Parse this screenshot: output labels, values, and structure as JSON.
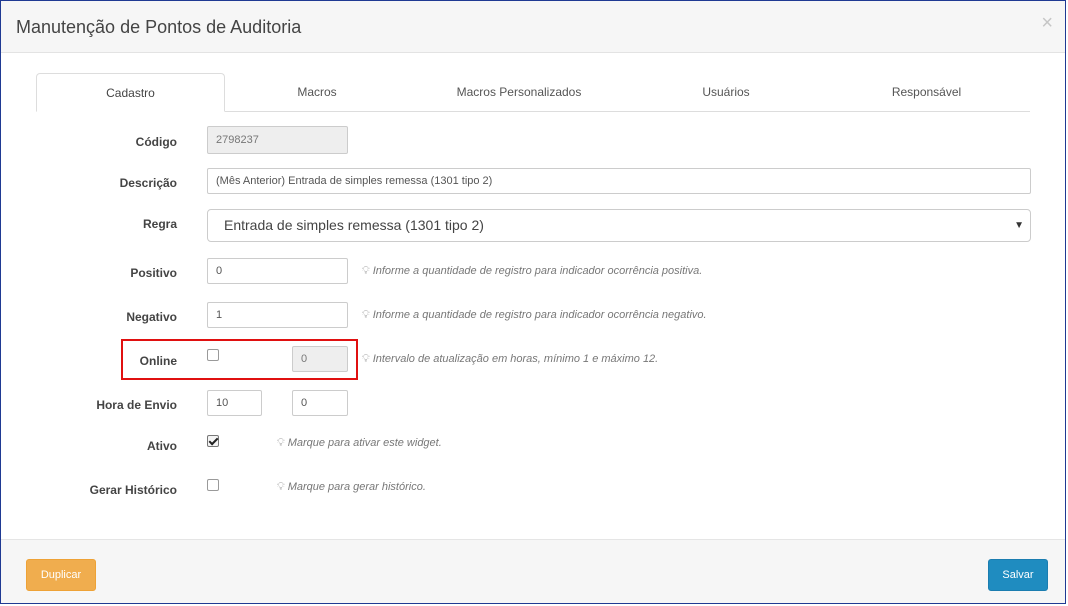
{
  "window": {
    "title": "Manutenção de Pontos de Auditoria",
    "close_symbol": "×"
  },
  "tabs": [
    {
      "label": "Cadastro",
      "active": true
    },
    {
      "label": "Macros",
      "active": false
    },
    {
      "label": "Macros Personalizados",
      "active": false
    },
    {
      "label": "Usuários",
      "active": false
    },
    {
      "label": "Responsável",
      "active": false
    }
  ],
  "form": {
    "codigo": {
      "label": "Código",
      "value": "2798237"
    },
    "descricao": {
      "label": "Descrição",
      "value": "(Mês Anterior) Entrada de simples remessa (1301 tipo 2)"
    },
    "regra": {
      "label": "Regra",
      "selected": "Entrada de simples remessa (1301 tipo 2)"
    },
    "positivo": {
      "label": "Positivo",
      "value": "0",
      "hint": "Informe a quantidade de registro para indicador ocorrência positiva."
    },
    "negativo": {
      "label": "Negativo",
      "value": "1",
      "hint": "Informe a quantidade de registro para indicador ocorrência negativo."
    },
    "online": {
      "label": "Online",
      "checked": false,
      "value": "0",
      "hint": "Intervalo de atualização em horas, mínimo 1 e máximo 12."
    },
    "hora_envio": {
      "label": "Hora de Envio",
      "hour": "10",
      "minute": "0"
    },
    "ativo": {
      "label": "Ativo",
      "checked": true,
      "hint": "Marque para ativar este widget."
    },
    "gerar_historico": {
      "label": "Gerar Histórico",
      "checked": false,
      "hint": "Marque para gerar histórico."
    }
  },
  "footer": {
    "duplicate_label": "Duplicar",
    "save_label": "Salvar"
  },
  "colors": {
    "duplicate_button": "#f0ad4e",
    "save_button": "#1f8cc0",
    "highlight_border": "#e01010"
  },
  "icons": {
    "hint_icon": "lightbulb-icon",
    "close_icon": "close-icon",
    "select_caret": "caret-down-icon"
  }
}
